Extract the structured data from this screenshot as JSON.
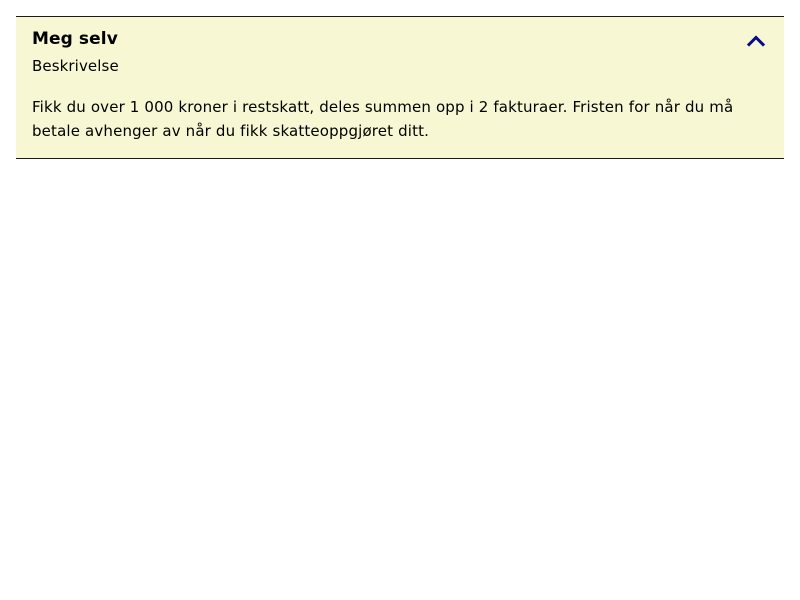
{
  "accordion": {
    "title": "Meg selv",
    "subtitle": "Beskrivelse",
    "expanded": true,
    "toggle_icon": "chevron-up-icon",
    "body_text": "Fikk du over 1 000 kroner i restskatt, deles summen opp i 2 fakturaer. Fristen for når du må betale avhenger av når du fikk skatteoppgjøret ditt."
  },
  "colors": {
    "panel_background": "#f7f8d3",
    "border": "#1a1a1a",
    "icon": "#0a0a8c",
    "text": "#000000"
  }
}
